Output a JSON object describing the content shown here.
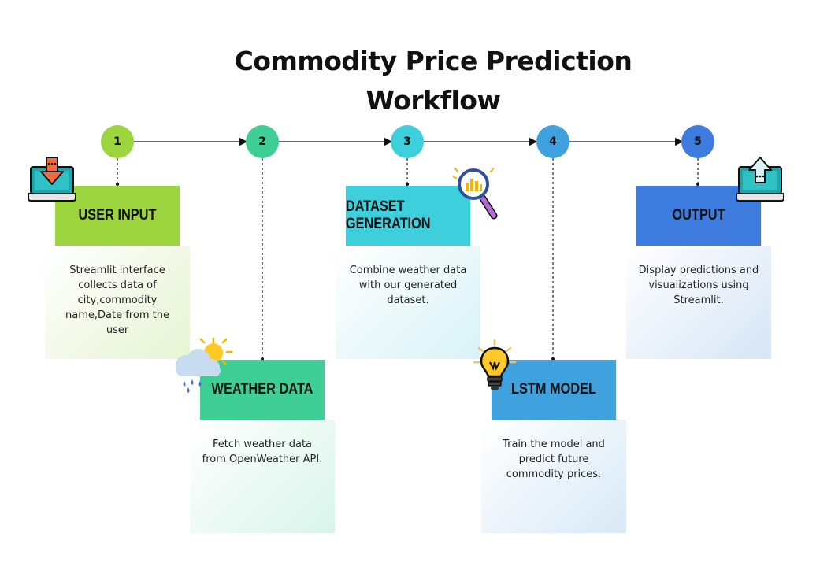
{
  "title_line1": "Commodity Price Prediction",
  "title_line2": "Workflow",
  "steps": [
    {
      "number": "1",
      "title": "USER INPUT",
      "description": "Streamlit interface collects data of city,commodity name,Date from the user",
      "color": "#9dd53f",
      "icon": "download-laptop-icon"
    },
    {
      "number": "2",
      "title": "WEATHER DATA",
      "description": "Fetch weather data from OpenWeather API.",
      "color": "#3fcf96",
      "icon": "weather-cloud-sun-icon"
    },
    {
      "number": "3",
      "title": "DATASET GENERATION",
      "description": "Combine weather data with our generated dataset.",
      "color": "#3ecfdd",
      "icon": "magnifier-chart-icon"
    },
    {
      "number": "4",
      "title": "LSTM MODEL",
      "description": "Train the model and predict future commodity prices.",
      "color": "#3fa2df",
      "icon": "lightbulb-icon"
    },
    {
      "number": "5",
      "title": "OUTPUT",
      "description": "Display predictions and visualizations using Streamlit.",
      "color": "#3d7cde",
      "icon": "upload-laptop-icon"
    }
  ]
}
